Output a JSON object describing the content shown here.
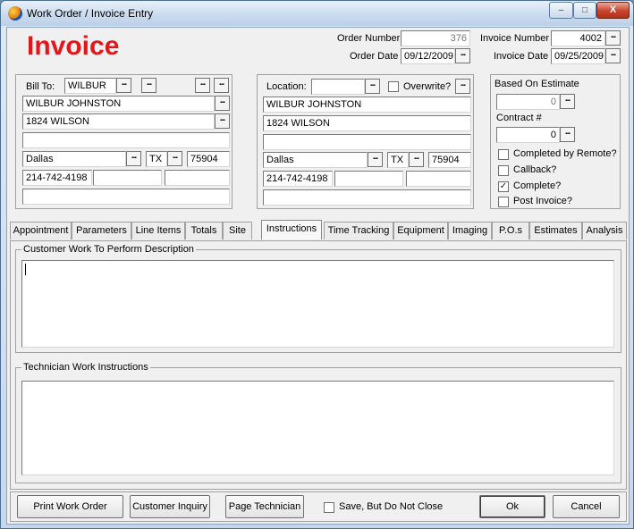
{
  "window": {
    "title": "Work Order /  Invoice Entry",
    "controls": {
      "minimize": "–",
      "maximize": "□",
      "close": "X"
    }
  },
  "header": {
    "heading": "Invoice",
    "heading_color": "#e3161a",
    "order_number_label": "Order Number",
    "order_number": "376",
    "order_date_label": "Order Date",
    "order_date": "09/12/2009",
    "invoice_number_label": "Invoice Number",
    "invoice_number": "4002",
    "invoice_date_label": "Invoice Date",
    "invoice_date": "09/25/2009"
  },
  "bill_to": {
    "label": "Bill To:",
    "code": "WILBUR",
    "name": "WILBUR JOHNSTON",
    "address1": "1824 WILSON",
    "address2": "",
    "city": "Dallas",
    "state": "TX",
    "zip": "75904",
    "phone": "214-742-4198"
  },
  "location": {
    "label": "Location:",
    "code": "",
    "overwrite_label": "Overwrite?",
    "name": "WILBUR JOHNSTON",
    "address1": "1824 WILSON",
    "address2": "",
    "city": "Dallas",
    "state": "TX",
    "zip": "75904",
    "phone": "214-742-4198"
  },
  "estimate": {
    "based_on_label": "Based On Estimate",
    "based_on_value": "0",
    "contract_label": "Contract #",
    "contract_value": "0",
    "checks": [
      {
        "label": "Completed by Remote?",
        "checked": false
      },
      {
        "label": "Callback?",
        "checked": false
      },
      {
        "label": "Complete?",
        "checked": true
      },
      {
        "label": "Post Invoice?",
        "checked": false
      }
    ],
    "check_mark": "✓"
  },
  "tabs": [
    {
      "label": "Appointment"
    },
    {
      "label": "Parameters"
    },
    {
      "label": "Line Items"
    },
    {
      "label": "Totals"
    },
    {
      "label": "Site"
    },
    {
      "label": "Instructions",
      "active": true
    },
    {
      "label": "Time Tracking"
    },
    {
      "label": "Equipment"
    },
    {
      "label": "Imaging"
    },
    {
      "label": "P.O.s"
    },
    {
      "label": "Estimates"
    },
    {
      "label": "Analysis"
    }
  ],
  "instructions": {
    "customer_label": "Customer Work To Perform Description",
    "customer_text": "",
    "technician_label": "Technician Work Instructions",
    "technician_text": ""
  },
  "footer": {
    "print": "Print Work Order",
    "customer_inquiry": "Customer Inquiry",
    "page_technician": "Page Technician",
    "save_no_close": "Save, But Do Not Close",
    "ok": "Ok",
    "cancel": "Cancel"
  },
  "ellipsis": "..."
}
